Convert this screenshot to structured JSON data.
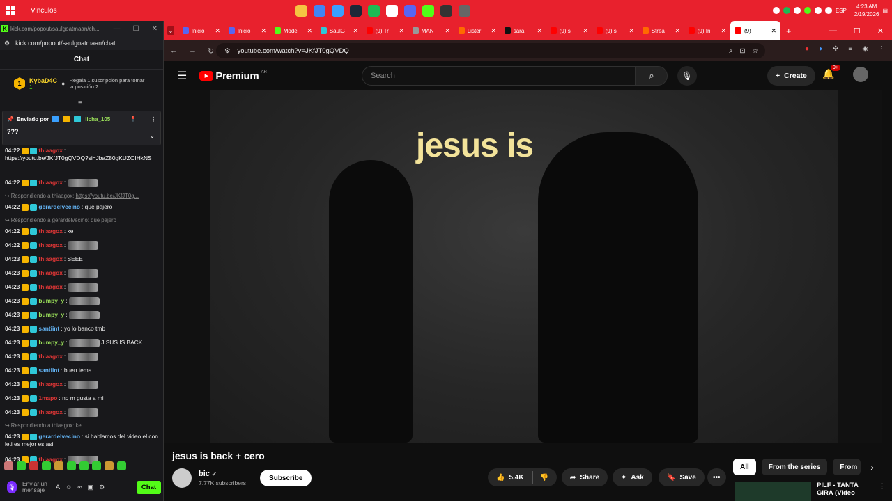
{
  "taskbar": {
    "title": "Vinculos",
    "lang": "ESP",
    "time": "4:23 AM",
    "date": "2/19/2026",
    "app_colors": [
      "#f5c542",
      "#4285f4",
      "#3aa0ff",
      "#1b2838",
      "#1db954",
      "#ffffff",
      "#5865f2",
      "#53fc18",
      "#333333",
      "#666666"
    ]
  },
  "kick": {
    "window_url_short": "kick.com/popout/saulgoatmaan/ch...",
    "url": "kick.com/popout/saulgoatmaan/chat",
    "chat_header": "Chat",
    "leader": {
      "rank": "1",
      "name": "KybaD4C",
      "count": "1",
      "gift_text": "Regala 1 suscripción para tomar la posición 2"
    },
    "pinned": {
      "label": "Enviado por",
      "user": "licha_105",
      "text": "???"
    },
    "messages": [
      {
        "ts": "04:22",
        "user": "thiaagox",
        "ucolor": "#e03636",
        "text": "",
        "link": "https://youtu.be/JKfJT0gQVDQ?si=JbaZ80gKUZOIHkNS"
      },
      {
        "ts": "04:22",
        "user": "thiaagox",
        "ucolor": "#e03636",
        "text": "",
        "emote": true
      },
      {
        "reply": "Respondiendo a thiaagox:",
        "reply_link": "https://youtu.be/JKfJT0g..."
      },
      {
        "ts": "04:22",
        "user": "gerardelvecino",
        "ucolor": "#64b5f6",
        "text": "que pajero"
      },
      {
        "reply": "Respondiendo a gerardelvecino: que pajero"
      },
      {
        "ts": "04:22",
        "user": "thiaagox",
        "ucolor": "#e03636",
        "text": "ke"
      },
      {
        "ts": "04:22",
        "user": "thiaagox",
        "ucolor": "#e03636",
        "text": "",
        "emote": true
      },
      {
        "ts": "04:23",
        "user": "thiaagox",
        "ucolor": "#e03636",
        "text": "SEEE"
      },
      {
        "ts": "04:23",
        "user": "thiaagox",
        "ucolor": "#e03636",
        "text": "",
        "emote": true
      },
      {
        "ts": "04:23",
        "user": "thiaagox",
        "ucolor": "#e03636",
        "text": "",
        "emote": true
      },
      {
        "ts": "04:23",
        "user": "bumpy_y",
        "ucolor": "#9be05a",
        "text": "",
        "emote": true
      },
      {
        "ts": "04:23",
        "user": "bumpy_y",
        "ucolor": "#9be05a",
        "text": "",
        "emote": true
      },
      {
        "ts": "04:23",
        "user": "santiint",
        "ucolor": "#64b5f6",
        "text": "yo lo banco tmb"
      },
      {
        "ts": "04:23",
        "user": "bumpy_y",
        "ucolor": "#9be05a",
        "text": "JISUS IS BACK",
        "emote": true
      },
      {
        "ts": "04:23",
        "user": "thiaagox",
        "ucolor": "#e03636",
        "text": "",
        "emote": true
      },
      {
        "ts": "04:23",
        "user": "santiint",
        "ucolor": "#64b5f6",
        "text": "buen tema"
      },
      {
        "ts": "04:23",
        "user": "thiaagox",
        "ucolor": "#e03636",
        "text": "",
        "emote": true
      },
      {
        "ts": "04:23",
        "user": "1mapo",
        "ucolor": "#e03636",
        "text": "no m gusta a mi"
      },
      {
        "ts": "04:23",
        "user": "thiaagox",
        "ucolor": "#e03636",
        "text": "",
        "emote": true
      },
      {
        "reply": "Respondiendo a thiaagox: ke"
      },
      {
        "ts": "04:23",
        "user": "gerardelvecino",
        "ucolor": "#64b5f6",
        "text": "si hablamos del video el con leti es mejor es asi"
      },
      {
        "ts": "04:23",
        "user": "thiaagox",
        "ucolor": "#e03636",
        "text": "",
        "emote": true
      }
    ],
    "input_placeholder": "Enviar un mensaje",
    "chat_button": "Chat"
  },
  "chrome": {
    "tabs": [
      {
        "label": "Inicio",
        "color": "#5865f2"
      },
      {
        "label": "Inicio",
        "color": "#5865f2"
      },
      {
        "label": "Mode",
        "color": "#53fc18"
      },
      {
        "label": "SaulG",
        "color": "#2fc8d8"
      },
      {
        "label": "(9) Tr",
        "color": "#ff0000"
      },
      {
        "label": "MAN",
        "color": "#999999"
      },
      {
        "label": "Lister",
        "color": "#ff6a00"
      },
      {
        "label": "sara",
        "color": "#111111"
      },
      {
        "label": "(9) si",
        "color": "#ff0000"
      },
      {
        "label": "(9) si",
        "color": "#ff0000"
      },
      {
        "label": "Strea",
        "color": "#ff6a00"
      },
      {
        "label": "(9) In",
        "color": "#ff0000"
      },
      {
        "label": "(9)",
        "color": "#ff0000",
        "active": true
      }
    ],
    "url": "youtube.com/watch?v=JKfJT0gQVDQ"
  },
  "youtube": {
    "brand": "Premium",
    "region": "AR",
    "search_placeholder": "Search",
    "create": "Create",
    "notifications": "9+",
    "video_caption": "jesus is",
    "title": "jesus is back + cero",
    "channel": "bic",
    "subscribers": "7.77K subscribers",
    "subscribe": "Subscribe",
    "likes": "5.4K",
    "share": "Share",
    "ask": "Ask",
    "save": "Save",
    "chips": [
      "All",
      "From the series",
      "From"
    ],
    "related_title": "PILF - TANTA GIRA (Video"
  }
}
